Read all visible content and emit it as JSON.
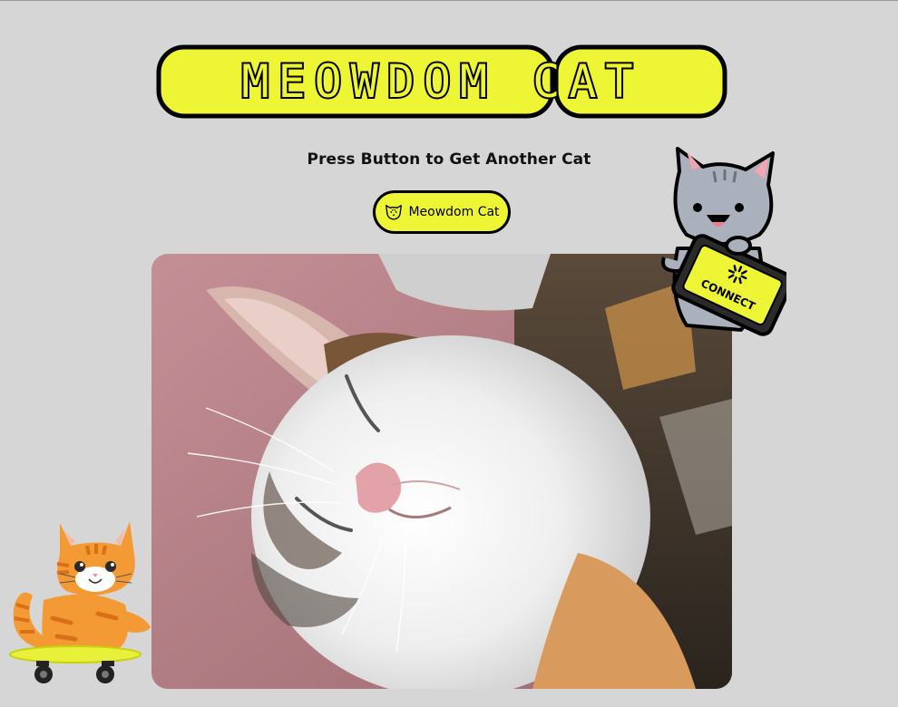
{
  "header": {
    "logo_text": "MEOWDOM CAT"
  },
  "main": {
    "subtitle": "Press Button to Get Another Cat",
    "button": {
      "label": "Meowdom Cat",
      "icon": "cat-face-icon"
    },
    "photo": {
      "subject": "sleeping-kitten"
    }
  },
  "stickers": {
    "gray_cat": {
      "icon": "gray-cat-sticker",
      "sign_text": "CONNECT"
    },
    "orange_cat": {
      "icon": "orange-cat-skateboard-sticker"
    }
  },
  "colors": {
    "background": "#d6d6d6",
    "accent": "#eef534",
    "outline": "#000000"
  }
}
